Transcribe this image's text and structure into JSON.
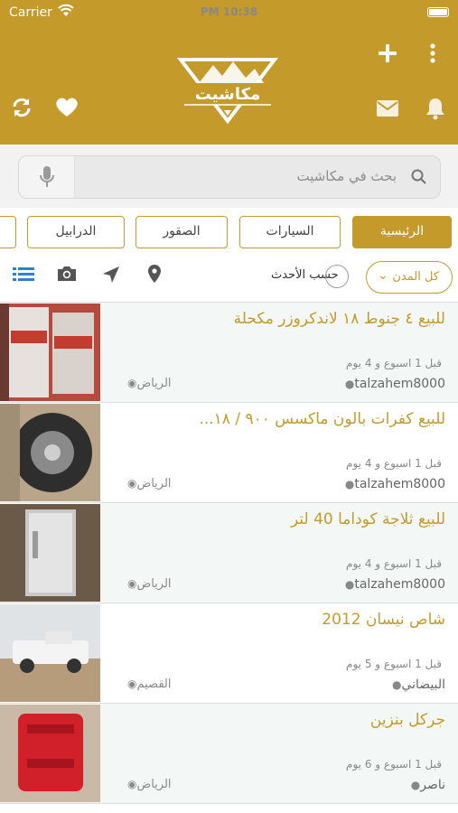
{
  "status": {
    "carrier": "Carrier",
    "time": "10:38 PM"
  },
  "header": {
    "logo_text": "مكاشيت"
  },
  "search": {
    "placeholder": "بحث في مكاشيت"
  },
  "categories": [
    {
      "label": "الرئيسية",
      "active": true
    },
    {
      "label": "السيارات",
      "active": false
    },
    {
      "label": "الصقور",
      "active": false
    },
    {
      "label": "الدرابيل",
      "active": false
    }
  ],
  "filters": {
    "sort_label": "حسب الأحدث",
    "city_label": "كل المدن"
  },
  "listings": [
    {
      "title": "للبيع ٤ جنوط ١٨ لاندكروزر مكحلة",
      "time": "قبل 1 اسبوع و 4 يوم",
      "user": "talzahem8000",
      "city": "الرياض"
    },
    {
      "title": "للبيع كفرات بالون ماكسس ٩٠٠ / ١٨...",
      "time": "قبل 1 اسبوع و 4 يوم",
      "user": "talzahem8000",
      "city": "الرياض"
    },
    {
      "title": "للبيع ثلاجة كوداما 40 لتر",
      "time": "قبل 1 اسبوع و 4 يوم",
      "user": "talzahem8000",
      "city": "الرياض"
    },
    {
      "title": "شاص نيسان 2012",
      "time": "قبل 1 اسبوع و 5 يوم",
      "user": "البيضاني",
      "city": "القصيم"
    },
    {
      "title": "جركل بنزين",
      "time": "قبل 1 اسبوع و 6 يوم",
      "user": "ناصر",
      "city": "الرياض"
    }
  ],
  "colors": {
    "accent": "#c49a2b",
    "row_alt": "#f3f8f7"
  }
}
